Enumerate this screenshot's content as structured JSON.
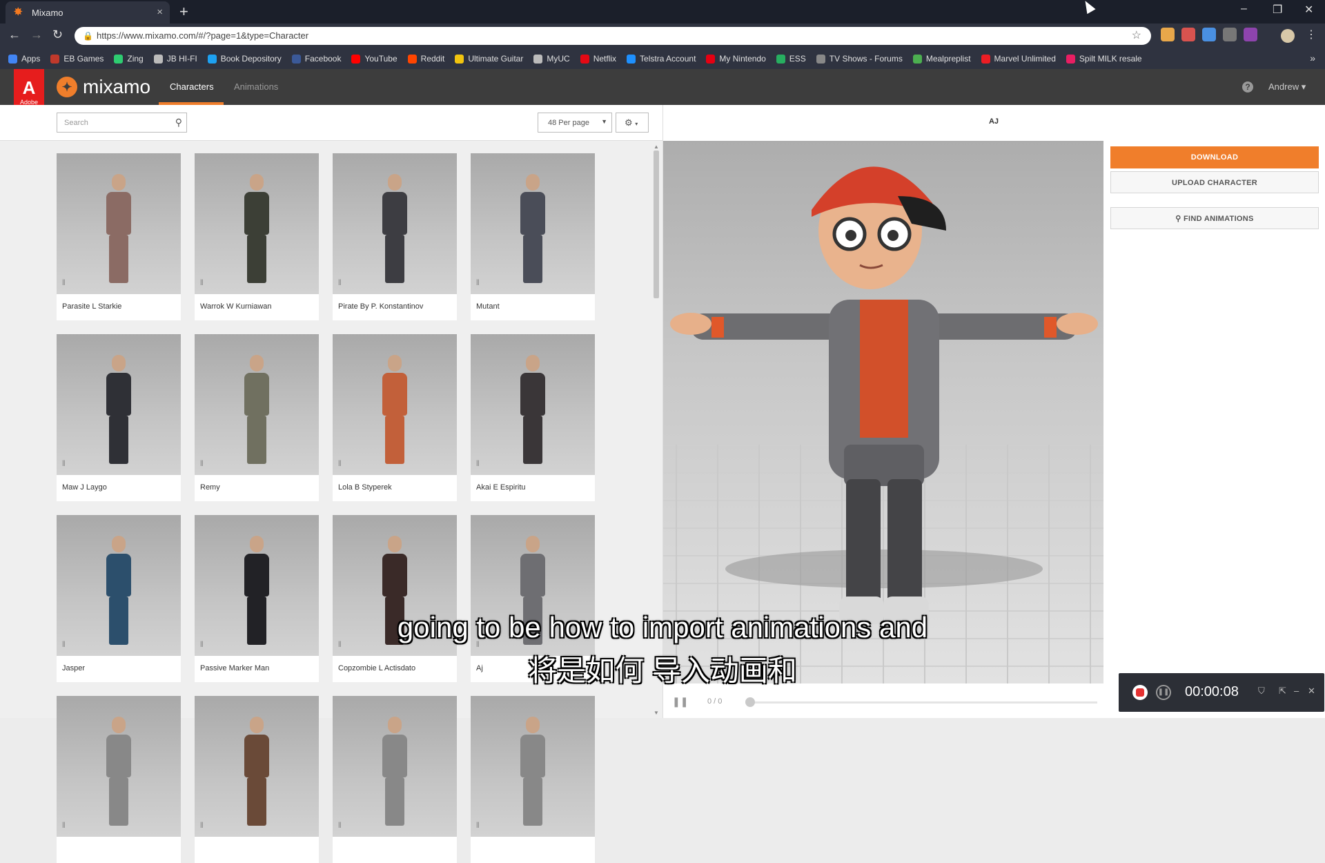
{
  "browser": {
    "tab_title": "Mixamo",
    "tab_close": "×",
    "new_tab": "+",
    "url": "https://www.mixamo.com/#/?page=1&type=Character",
    "bookmarks": [
      "Apps",
      "EB Games",
      "Zing",
      "JB HI-FI",
      "Book Depository",
      "Facebook",
      "YouTube",
      "Reddit",
      "Ultimate Guitar",
      "MyUC",
      "Netflix",
      "Telstra Account",
      "My Nintendo",
      "ESS",
      "TV Shows - Forums",
      "Mealpreplist",
      "Marvel Unlimited",
      "Spilt MILK resale"
    ],
    "bookmark_colors": [
      "#4285f4",
      "#c0392b",
      "#2ecc71",
      "#bbbbbb",
      "#1da1f2",
      "#3b5998",
      "#ff0000",
      "#ff4500",
      "#f1c40f",
      "#bbbbbb",
      "#e50914",
      "#1e90ff",
      "#e60012",
      "#27ae60",
      "#888888",
      "#4caf50",
      "#ec1d24",
      "#e91e63"
    ],
    "accent": "#f07e2b"
  },
  "app": {
    "adobe_text": "A",
    "adobe_sub": "Adobe",
    "brand": "mixamo",
    "tabs": [
      {
        "label": "Characters"
      },
      {
        "label": "Animations"
      }
    ],
    "help": "?",
    "user": "Andrew"
  },
  "toolbar": {
    "search_placeholder": "Search",
    "per_page": "48 Per page",
    "settings_icon": "gear-icon"
  },
  "characters": [
    {
      "name": "Parasite L Starkie",
      "color": "#8b6b64"
    },
    {
      "name": "Warrok W Kurniawan",
      "color": "#3c3f36"
    },
    {
      "name": "Pirate By P. Konstantinov",
      "color": "#3d3d42"
    },
    {
      "name": "Mutant",
      "color": "#4a4d58"
    },
    {
      "name": "Maw J Laygo",
      "color": "#2f3036"
    },
    {
      "name": "Remy",
      "color": "#707060"
    },
    {
      "name": "Lola B Styperek",
      "color": "#c2603a"
    },
    {
      "name": "Akai E Espiritu",
      "color": "#3a3638"
    },
    {
      "name": "Jasper",
      "color": "#2c4f6c"
    },
    {
      "name": "Passive Marker Man",
      "color": "#222226"
    },
    {
      "name": "Copzombie L Actisdato",
      "color": "#3a2a28"
    },
    {
      "name": "Aj",
      "color": "#6e6e72"
    },
    {
      "name": "",
      "color": "#888"
    },
    {
      "name": "",
      "color": "#6a4a38"
    },
    {
      "name": "",
      "color": "#888"
    },
    {
      "name": "",
      "color": "#888"
    }
  ],
  "preview": {
    "character_name": "AJ",
    "frames": "0 / 0"
  },
  "actions": {
    "download": "DOWNLOAD",
    "upload": "UPLOAD CHARACTER",
    "find": "FIND ANIMATIONS"
  },
  "recorder": {
    "time": "00:00:08"
  },
  "captions": {
    "english": "going to be how to import animations and",
    "chinese": "将是如何 导入动画和"
  }
}
